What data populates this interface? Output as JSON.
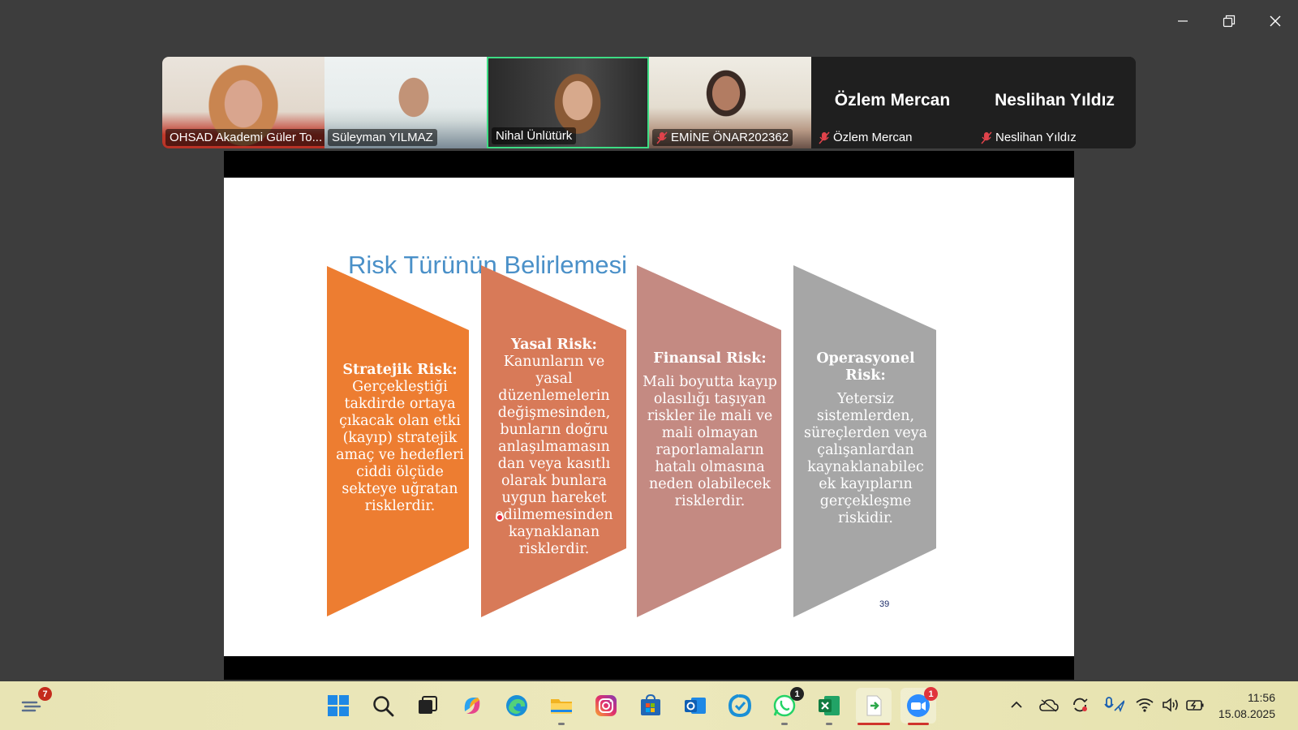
{
  "participants": [
    {
      "name": "OHSAD Akademi Güler To...",
      "muted": false
    },
    {
      "name": "Süleyman YILMAZ",
      "muted": false
    },
    {
      "name": "Nihal Ünlütürk",
      "muted": false,
      "active": true
    },
    {
      "name": "EMİNE ÖNAR202362",
      "muted": true
    },
    {
      "name": "Özlem Mercan",
      "muted": true,
      "big_name": "Özlem Mercan"
    },
    {
      "name": "Neslihan Yıldız",
      "muted": true,
      "big_name": "Neslihan Yıldız"
    }
  ],
  "slide": {
    "title": "Risk Türünün Belirlemesi",
    "page_number": "39",
    "boxes": [
      {
        "heading": "Stratejik Risk:",
        "text": "Gerçekleştiği takdirde ortaya çıkacak olan etki (kayıp) stratejik amaç ve hedefleri ciddi ölçüde sekteye uğratan risklerdir.",
        "color": "#ed7d31"
      },
      {
        "heading": "Yasal Risk:",
        "text": "Kanunların ve yasal düzenlemelerin değişmesinden, bunların doğru anlaşılmamasın dan veya kasıtlı olarak bunlara uygun hareket edilmemesinden kaynaklanan risklerdir.",
        "color": "#d87a58"
      },
      {
        "heading": "Finansal Risk:",
        "text": "Mali boyutta kayıp olasılığı taşıyan riskler ile mali ve mali olmayan raporlamaların hatalı olmasına neden olabilecek risklerdir.",
        "color": "#c48a82"
      },
      {
        "heading": "Operasyonel Risk:",
        "text": "Yetersiz sistemlerden, süreçlerden veya çalışanlardan kaynaklanabilec ek kayıpların gerçekleşme riskidir.",
        "color": "#a6a6a6"
      }
    ]
  },
  "taskbar": {
    "widgets_badge": "7",
    "whatsapp_badge": "1",
    "zoom_badge": "1",
    "time": "11:56",
    "date": "15.08.2025"
  }
}
